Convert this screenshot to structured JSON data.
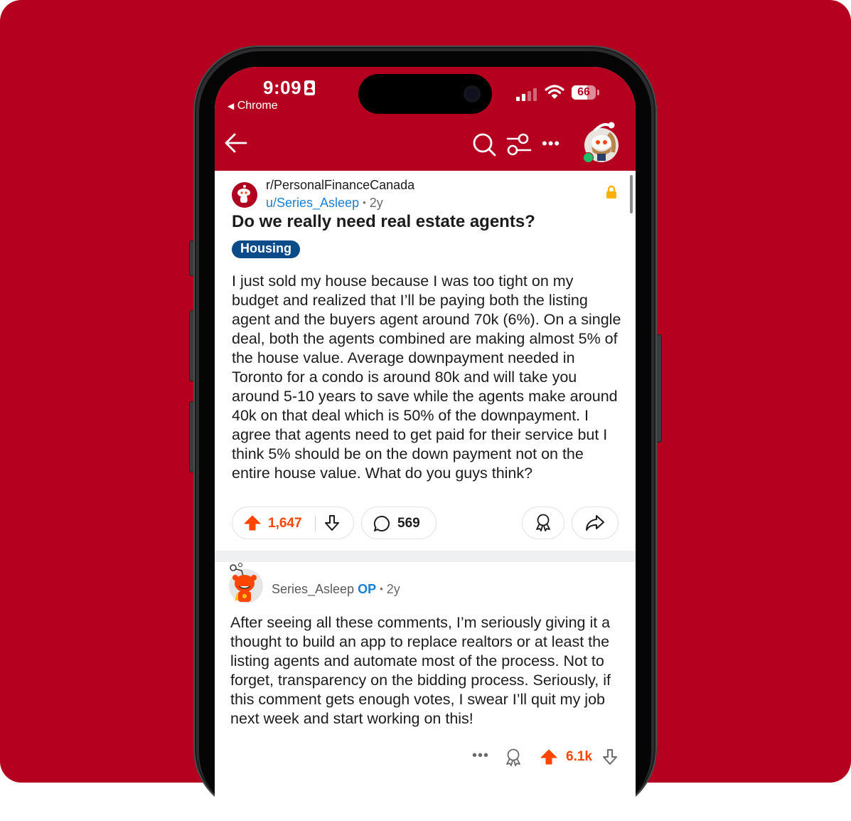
{
  "colors": {
    "brand_red": "#b5001f",
    "upvote_orange": "#ff4500",
    "link_blue": "#1a7fd4",
    "flair_blue": "#0b4b8a",
    "lock_yellow": "#ffb000",
    "online_green": "#1fbf6a"
  },
  "status_bar": {
    "time": "9:09",
    "back_app": "Chrome",
    "back_icon": "triangle-left-icon",
    "battery_percent": "66",
    "battery_level": 0.66,
    "signal_bars_active": 2,
    "signal_bars_total": 4
  },
  "nav": {
    "back_icon": "arrow-left-icon",
    "search_icon": "search-icon",
    "filter_icon": "filter-sliders-icon",
    "more_label": "•••",
    "avatar_icon": "user-avatar-santa-snoo",
    "online": true
  },
  "post": {
    "subreddit": "r/PersonalFinanceCanada",
    "author": "u/Series_Asleep",
    "separator": "•",
    "age": "2y",
    "locked": true,
    "title": "Do we really need real estate agents?",
    "flair": "Housing",
    "body": "I just sold my house because I was too tight on my budget and realized that I’ll be paying both the listing agent and the buyers agent around 70k (6%). On a single deal, both the agents combined are making almost 5% of the house value. Average downpayment needed in Toronto for a condo is around 80k and will take you around 5-10 years to save while the agents make around 40k on that deal which is 50% of the downpayment. I agree that agents need to get paid for their service but I think 5% should be on the down payment not on the entire house value. What do you guys think?",
    "votes": "1,647",
    "upvoted": true,
    "comments": "569"
  },
  "comment": {
    "author": "Series_Asleep",
    "op_badge": "OP",
    "separator": "•",
    "age": "2y",
    "body": "After seeing all these comments, I’m seriously giving it a thought to build an app to replace realtors or at least the listing agents and automate most of the process. Not to forget, transparency on the bidding process. Seriously, if this comment gets enough votes, I swear I’ll quit my job next week and start working on this!",
    "more_label": "•••",
    "votes": "6.1k",
    "upvoted": true
  }
}
